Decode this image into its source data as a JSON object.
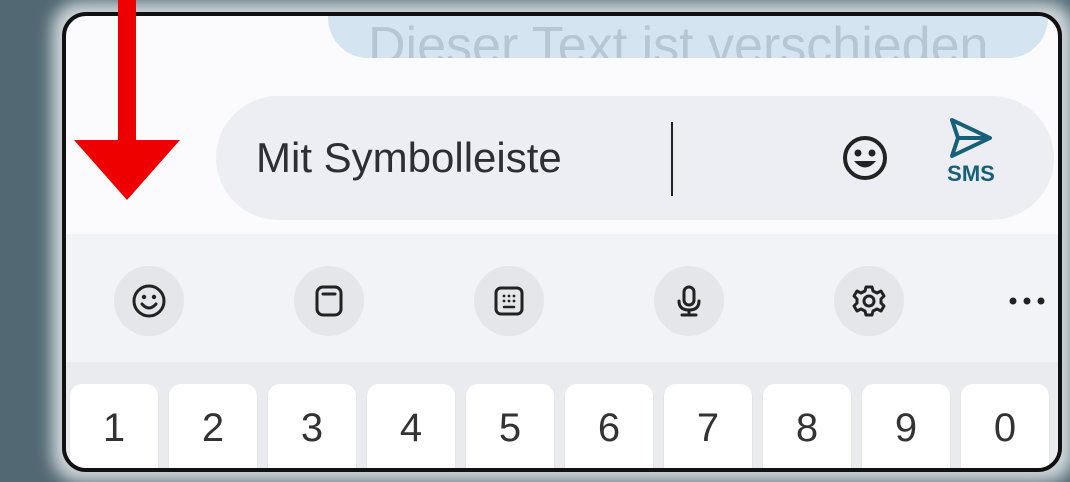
{
  "colors": {
    "background": "#526873",
    "phone_bg": "#fbfbfd",
    "bubble": "#d5e4f1",
    "compose_bg": "#eceef3",
    "accent": "#16607a",
    "annotation_arrow": "#ee0000"
  },
  "message_bubble": {
    "text": "Dieser Text ist verschieden"
  },
  "compose": {
    "value": "Mit Symbolleiste",
    "emoji_icon": "smiley-icon",
    "send_icon": "send-icon",
    "send_label": "SMS"
  },
  "toolbar": {
    "items": [
      {
        "icon": "emoji-icon"
      },
      {
        "icon": "clipboard-icon"
      },
      {
        "icon": "keypad-icon"
      },
      {
        "icon": "microphone-icon"
      },
      {
        "icon": "gear-icon"
      },
      {
        "icon": "more-icon"
      }
    ]
  },
  "keyboard": {
    "number_row": [
      "1",
      "2",
      "3",
      "4",
      "5",
      "6",
      "7",
      "8",
      "9",
      "0"
    ]
  },
  "annotation": {
    "icon": "down-arrow-icon"
  }
}
